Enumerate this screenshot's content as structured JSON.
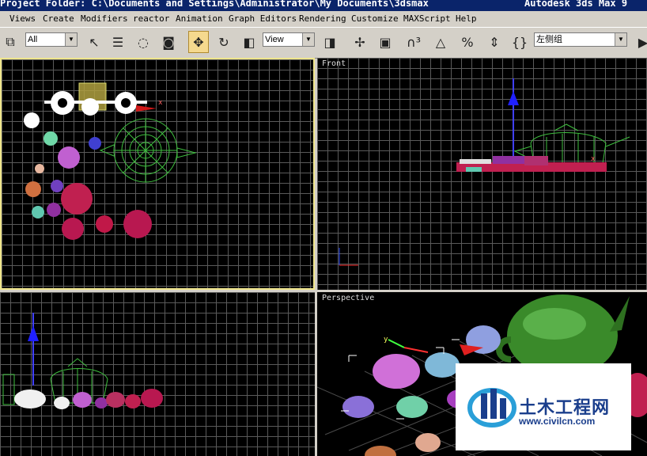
{
  "window": {
    "title_left": "Project Folder: C:\\Documents and Settings\\Administrator\\My Documents\\3dsmax",
    "title_right": "Autodesk 3ds Max 9"
  },
  "menu": [
    "Views",
    "Create",
    "Modifiers",
    "reactor",
    "Animation",
    "Graph Editors",
    "Rendering",
    "Customize",
    "MAXScript",
    "Help"
  ],
  "toolbar": {
    "selection_filter": "All",
    "reference_coord": "View",
    "named_selection": "左侧组",
    "icons": [
      "link-icon",
      "select-arrow-icon",
      "select-by-name-icon",
      "region-select-icon",
      "window-crossing-icon",
      "move-icon",
      "rotate-icon",
      "scale-icon",
      "pivot-icon",
      "manipulate-icon",
      "keyboard-shortcut-icon",
      "snap-3d-icon",
      "angle-snap-icon",
      "percent-snap-icon",
      "spinner-snap-icon",
      "mirror-icon",
      "render-icon"
    ]
  },
  "viewports": {
    "top_left": {
      "label": ""
    },
    "front": {
      "label": "Front"
    },
    "left": {
      "label": ""
    },
    "perspective": {
      "label": "Perspective"
    }
  },
  "watermark": {
    "main": "土木工程网",
    "url": "www.civilcn.com"
  }
}
